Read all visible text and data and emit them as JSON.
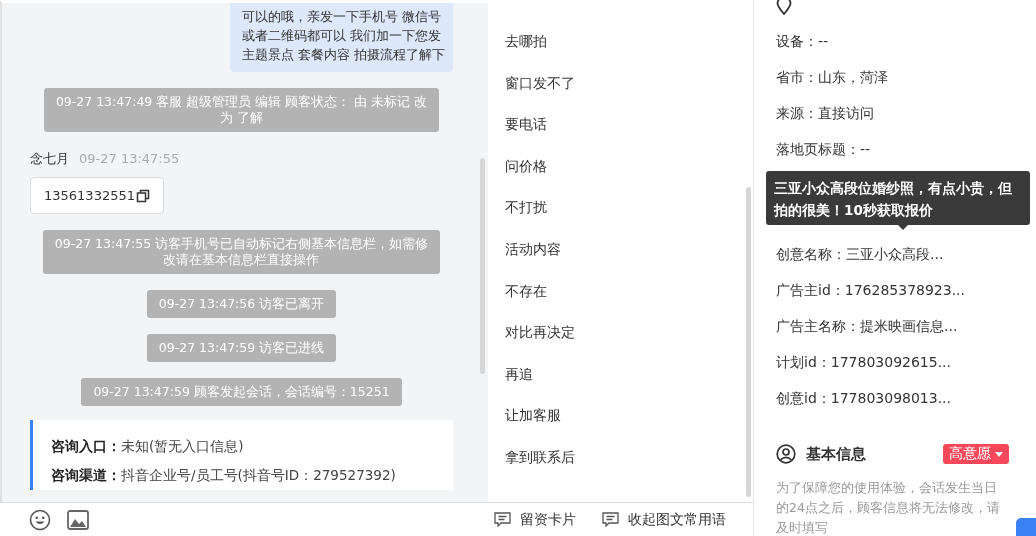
{
  "chat": {
    "messages": [
      {
        "kind": "bubble",
        "lines": [
          "可以的哦，亲发一下手机号 微信号",
          "或者二维码都可以 我们加一下您发",
          "主题景点 套餐内容 拍摄流程了解下"
        ]
      },
      {
        "kind": "system",
        "lines": [
          "09-27 13:47:49 客服 超级管理员 编辑 顾客状态： 由 未标记 改",
          "为 了解"
        ]
      },
      {
        "kind": "contact",
        "name": "念七月",
        "time": "09-27 13:47:55",
        "phone": "13561332551"
      },
      {
        "kind": "system",
        "lines": [
          "09-27 13:47:55 访客手机号已自动标记右侧基本信息栏，如需修",
          "改请在基本信息栏直接操作"
        ]
      },
      {
        "kind": "system",
        "lines": [
          "09-27 13:47:56 访客已离开"
        ]
      },
      {
        "kind": "system",
        "lines": [
          "09-27 13:47:59 访客已进线"
        ]
      },
      {
        "kind": "system",
        "lines": [
          "09-27 13:47:59 顾客发起会话，会话编号：15251"
        ]
      },
      {
        "kind": "info",
        "rows": [
          {
            "label": "咨询入口：",
            "value": "未知(暂无入口信息)"
          },
          {
            "label": "咨询渠道：",
            "value": "抖音企业号/员工号(抖音号ID：279527392)"
          }
        ]
      }
    ]
  },
  "phrases": [
    "去哪拍",
    "窗口发不了",
    "要电话",
    "问价格",
    "不打扰",
    "活动内容",
    "不存在",
    "对比再决定",
    "再追",
    "让加客服",
    "拿到联系后"
  ],
  "bottom_bar": {
    "tools": [
      "留资卡片",
      "收起图文常用语"
    ]
  },
  "source_info": {
    "rows_before": [
      "设备：--",
      "省市：山东，菏泽",
      "来源：直接访问",
      "落地页标题：--"
    ],
    "tooltip": "三亚小众高段位婚纱照，有点小贵，但拍的很美！10秒获取报价",
    "rows_after": [
      "创意名称：三亚小众高段...",
      "广告主id：176285378923...",
      "广告主名称：提米映画信息...",
      "计划id：177803092615...",
      "创意id：177803098013..."
    ]
  },
  "basic_info": {
    "title": "基本信息",
    "tag": "高意愿",
    "note": "为了保障您的使用体验，会话发生当日的24点之后，顾客信息将无法修改，请及时填写"
  }
}
